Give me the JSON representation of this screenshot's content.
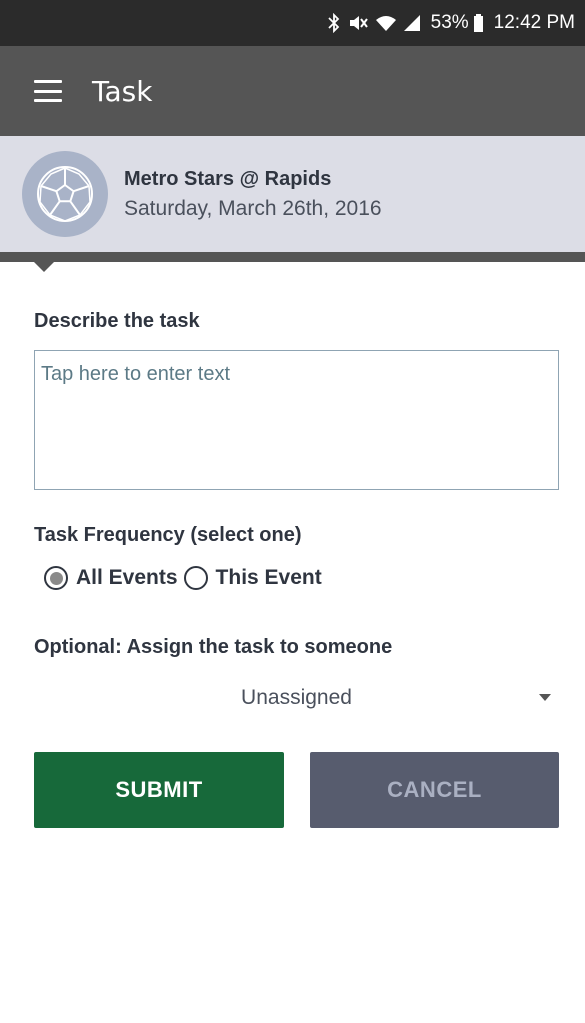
{
  "status_bar": {
    "icons": [
      "bluetooth-icon",
      "mute-icon",
      "wifi-icon",
      "signal-icon"
    ],
    "battery": "53%",
    "time": "12:42 PM"
  },
  "app_bar": {
    "title": "Task"
  },
  "event": {
    "title": "Metro Stars @ Rapids",
    "date": "Saturday, March 26th, 2016",
    "avatar_icon": "soccer-ball-icon"
  },
  "form": {
    "describe_label": "Describe the task",
    "task_input": {
      "placeholder": "Tap here to enter text",
      "value": ""
    },
    "frequency_label": "Task Frequency (select one)",
    "frequency_options": [
      {
        "label": "All Events",
        "selected": true
      },
      {
        "label": "This Event",
        "selected": false
      }
    ],
    "assign_label": "Optional: Assign the task to someone",
    "assignee": "Unassigned"
  },
  "buttons": {
    "submit": "SUBMIT",
    "cancel": "CANCEL"
  },
  "colors": {
    "app_bar": "#555555",
    "status_bar": "#2b2b2b",
    "header_bg": "#dcdde6",
    "submit": "#17693a",
    "cancel": "#575c6e"
  }
}
